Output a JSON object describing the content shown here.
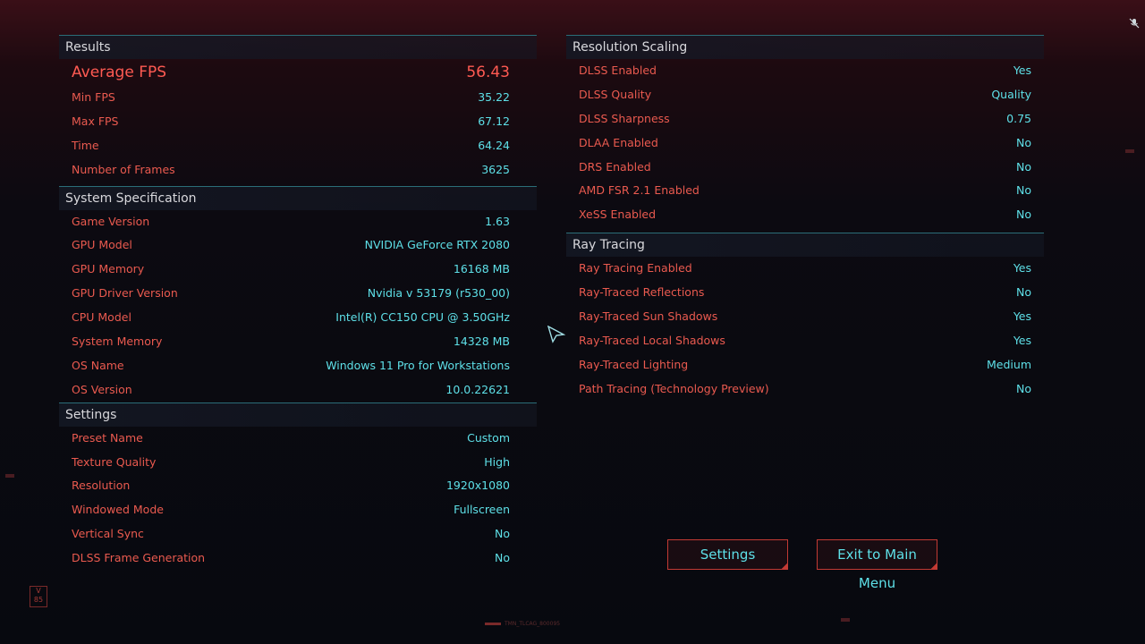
{
  "results": {
    "header": "Results",
    "avg_label": "Average FPS",
    "avg_value": "56.43",
    "rows": [
      {
        "label": "Min FPS",
        "value": "35.22"
      },
      {
        "label": "Max FPS",
        "value": "67.12"
      },
      {
        "label": "Time",
        "value": "64.24"
      },
      {
        "label": "Number of Frames",
        "value": "3625"
      }
    ]
  },
  "system": {
    "header": "System Specification",
    "rows": [
      {
        "label": "Game Version",
        "value": "1.63"
      },
      {
        "label": "GPU Model",
        "value": "NVIDIA GeForce RTX 2080"
      },
      {
        "label": "GPU Memory",
        "value": "16168 MB"
      },
      {
        "label": "GPU Driver Version",
        "value": "Nvidia v 53179 (r530_00)"
      },
      {
        "label": "CPU Model",
        "value": "Intel(R) CC150 CPU @ 3.50GHz"
      },
      {
        "label": "System Memory",
        "value": "14328 MB"
      },
      {
        "label": "OS Name",
        "value": "Windows 11 Pro for Workstations"
      },
      {
        "label": "OS Version",
        "value": "10.0.22621"
      }
    ]
  },
  "settings": {
    "header": "Settings",
    "rows": [
      {
        "label": "Preset Name",
        "value": "Custom"
      },
      {
        "label": "Texture Quality",
        "value": "High"
      },
      {
        "label": "Resolution",
        "value": "1920x1080"
      },
      {
        "label": "Windowed Mode",
        "value": "Fullscreen"
      },
      {
        "label": "Vertical Sync",
        "value": "No"
      },
      {
        "label": "DLSS Frame Generation",
        "value": "No"
      }
    ]
  },
  "resolution_scaling": {
    "header": "Resolution Scaling",
    "rows": [
      {
        "label": "DLSS Enabled",
        "value": "Yes"
      },
      {
        "label": "DLSS Quality",
        "value": "Quality"
      },
      {
        "label": "DLSS Sharpness",
        "value": "0.75"
      },
      {
        "label": "DLAA Enabled",
        "value": "No"
      },
      {
        "label": "DRS Enabled",
        "value": "No"
      },
      {
        "label": "AMD FSR 2.1 Enabled",
        "value": "No"
      },
      {
        "label": "XeSS Enabled",
        "value": "No"
      }
    ]
  },
  "ray_tracing": {
    "header": "Ray Tracing",
    "rows": [
      {
        "label": "Ray Tracing Enabled",
        "value": "Yes"
      },
      {
        "label": "Ray-Traced Reflections",
        "value": "No"
      },
      {
        "label": "Ray-Traced Sun Shadows",
        "value": "Yes"
      },
      {
        "label": "Ray-Traced Local Shadows",
        "value": "Yes"
      },
      {
        "label": "Ray-Traced Lighting",
        "value": "Medium"
      },
      {
        "label": "Path Tracing (Technology Preview)",
        "value": "No"
      }
    ]
  },
  "buttons": {
    "settings": "Settings",
    "exit": "Exit to Main Menu"
  },
  "decor": {
    "badge": "V\n85",
    "bottom_code": "TMN_TLCAG_800095"
  },
  "colors": {
    "label": "#ea5a4f",
    "value": "#5ee0e8",
    "header_line": "#2b6d78",
    "button_border": "#c23a34"
  }
}
